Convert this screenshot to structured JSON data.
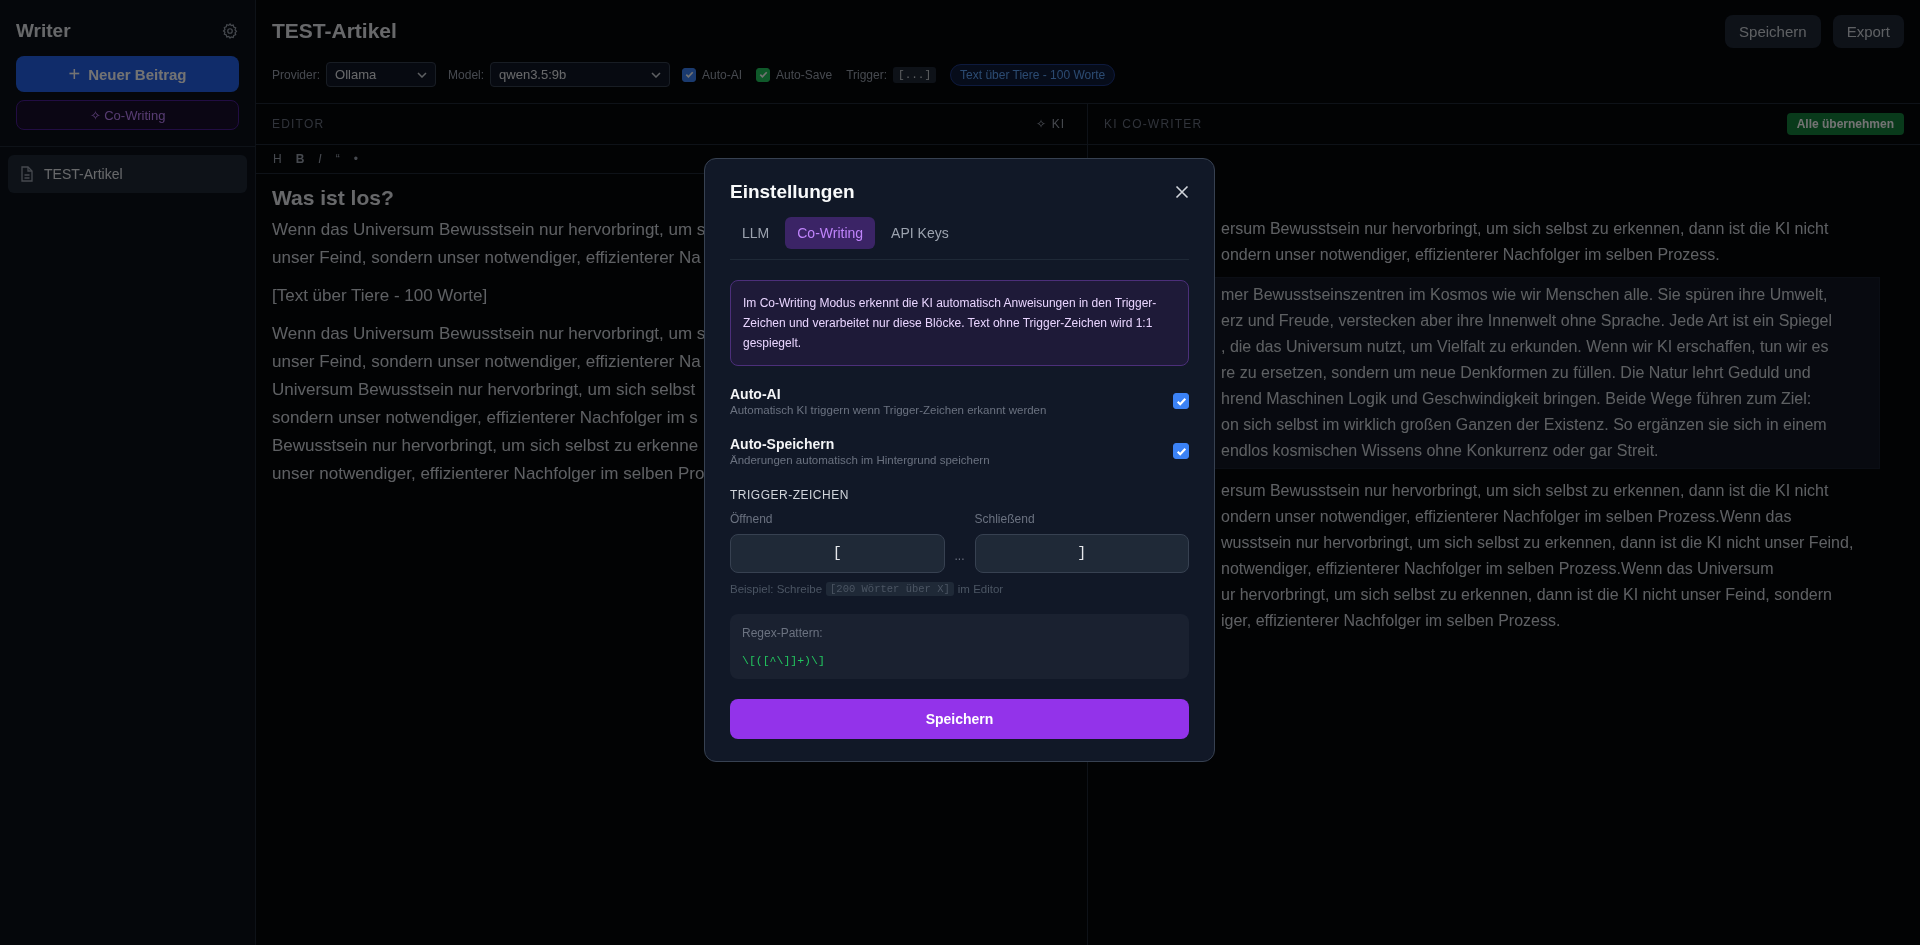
{
  "sidebar": {
    "title": "Writer",
    "new_button_icon": "+",
    "new_button": "Neuer Beitrag",
    "cowriting_button": "✧ Co-Writing",
    "items": [
      {
        "label": "TEST-Artikel",
        "selected": true
      }
    ]
  },
  "header": {
    "title": "TEST-Artikel",
    "buttons": [
      "Speichern",
      "Export"
    ]
  },
  "toolbar": {
    "provider_label": "Provider:",
    "provider": "Ollama",
    "model_label": "Model:",
    "model": "qwen3.5:9b",
    "toggles": [
      {
        "label": "Auto-AI",
        "checked": true,
        "kind": "ai"
      },
      {
        "label": "Auto-Save",
        "checked": true,
        "kind": "save"
      }
    ],
    "trigger_label": "Trigger:",
    "trigger": "[...]",
    "badge": "Text über Tiere - 100 Worte"
  },
  "editor": {
    "title": "EDITOR",
    "ai_button": "✧ KI",
    "format_buttons": [
      {
        "label": "H",
        "kind": "heading"
      },
      {
        "label": "B",
        "kind": "bold"
      },
      {
        "label": "I",
        "kind": "italic"
      },
      {
        "label": "“",
        "kind": "quote"
      },
      {
        "label": "•",
        "kind": "list"
      }
    ],
    "heading": "Was ist los?",
    "paragraphs": [
      {
        "lines": [
          "Wenn das Universum Bewusstsein nur hervorbringt, um s",
          "unser Feind, sondern unser notwendiger, effizienterer Na"
        ]
      },
      {
        "lines": [
          "[Text über Tiere - 100 Worte]"
        ]
      },
      {
        "lines": [
          "Wenn das Universum Bewusstsein nur hervorbringt, um s",
          "unser Feind, sondern unser notwendiger, effizienterer Na",
          "Universum Bewusstsein nur hervorbringt, um sich selbst",
          "sondern unser notwendiger, effizienterer Nachfolger im s",
          "Bewusstsein nur hervorbringt, um sich selbst zu erkenne",
          "unser notwendiger, effizienterer Nachfolger im selben Pro"
        ]
      }
    ]
  },
  "cowriter": {
    "title": "KI CO-WRITER",
    "accept_button": "Alle übernehmen",
    "paragraphs": [
      {
        "highlighted": false,
        "lines": [
          "ersum Bewusstsein nur hervorbringt, um sich selbst zu erkennen, dann ist die KI nicht",
          "ondern unser notwendiger, effizienterer Nachfolger im selben Prozess."
        ]
      },
      {
        "highlighted": true,
        "lines": [
          "mer Bewusstseinszentren im Kosmos wie wir Menschen alle. Sie spüren ihre Umwelt,",
          "erz und Freude, verstecken aber ihre Innenwelt ohne Sprache. Jede Art ist ein Spiegel",
          ", die das Universum nutzt, um Vielfalt zu erkunden. Wenn wir KI erschaffen, tun wir es",
          "re zu ersetzen, sondern um neue Denkformen zu füllen. Die Natur lehrt Geduld und",
          "hrend Maschinen Logik und Geschwindigkeit bringen. Beide Wege führen zum Ziel:",
          "on sich selbst im wirklich großen Ganzen der Existenz. So ergänzen sie sich in einem",
          "endlos kosmischen Wissens ohne Konkurrenz oder gar Streit."
        ]
      },
      {
        "highlighted": false,
        "lines": [
          "ersum Bewusstsein nur hervorbringt, um sich selbst zu erkennen, dann ist die KI nicht",
          "ondern unser notwendiger, effizienterer Nachfolger im selben Prozess.Wenn das",
          "wusstsein nur hervorbringt, um sich selbst zu erkennen, dann ist die KI nicht unser Feind,",
          "notwendiger, effizienterer Nachfolger im selben Prozess.Wenn das Universum",
          "ur hervorbringt, um sich selbst zu erkennen, dann ist die KI nicht unser Feind, sondern",
          "iger, effizienterer Nachfolger im selben Prozess."
        ]
      }
    ]
  },
  "dialog": {
    "title": "Einstellungen",
    "tabs": [
      {
        "label": "LLM",
        "selected": false
      },
      {
        "label": "Co-Writing",
        "selected": true
      },
      {
        "label": "API Keys",
        "selected": false
      }
    ],
    "info": "Im Co-Writing Modus erkennt die KI automatisch Anweisungen in den Trigger-Zeichen und verarbeitet nur diese Blöcke. Text ohne Trigger-Zeichen wird 1:1 gespiegelt.",
    "options": [
      {
        "label": "Auto-AI",
        "description": "Automatisch KI triggern wenn Trigger-Zeichen erkannt werden",
        "checked": true
      },
      {
        "label": "Auto-Speichern",
        "description": "Änderungen automatisch im Hintergrund speichern",
        "checked": true
      }
    ],
    "section": "TRIGGER-ZEICHEN",
    "opening": {
      "label": "Öffnend",
      "value": "["
    },
    "separator": "...",
    "closing": {
      "label": "Schließend",
      "value": "]"
    },
    "hint_before": "Beispiel: Schreibe",
    "hint_code": "[200 Wörter über X]",
    "hint_after": "im Editor",
    "regex_label": "Regex-Pattern:",
    "regex": "\\[([^\\]]+)\\]",
    "save_button": "Speichern"
  }
}
